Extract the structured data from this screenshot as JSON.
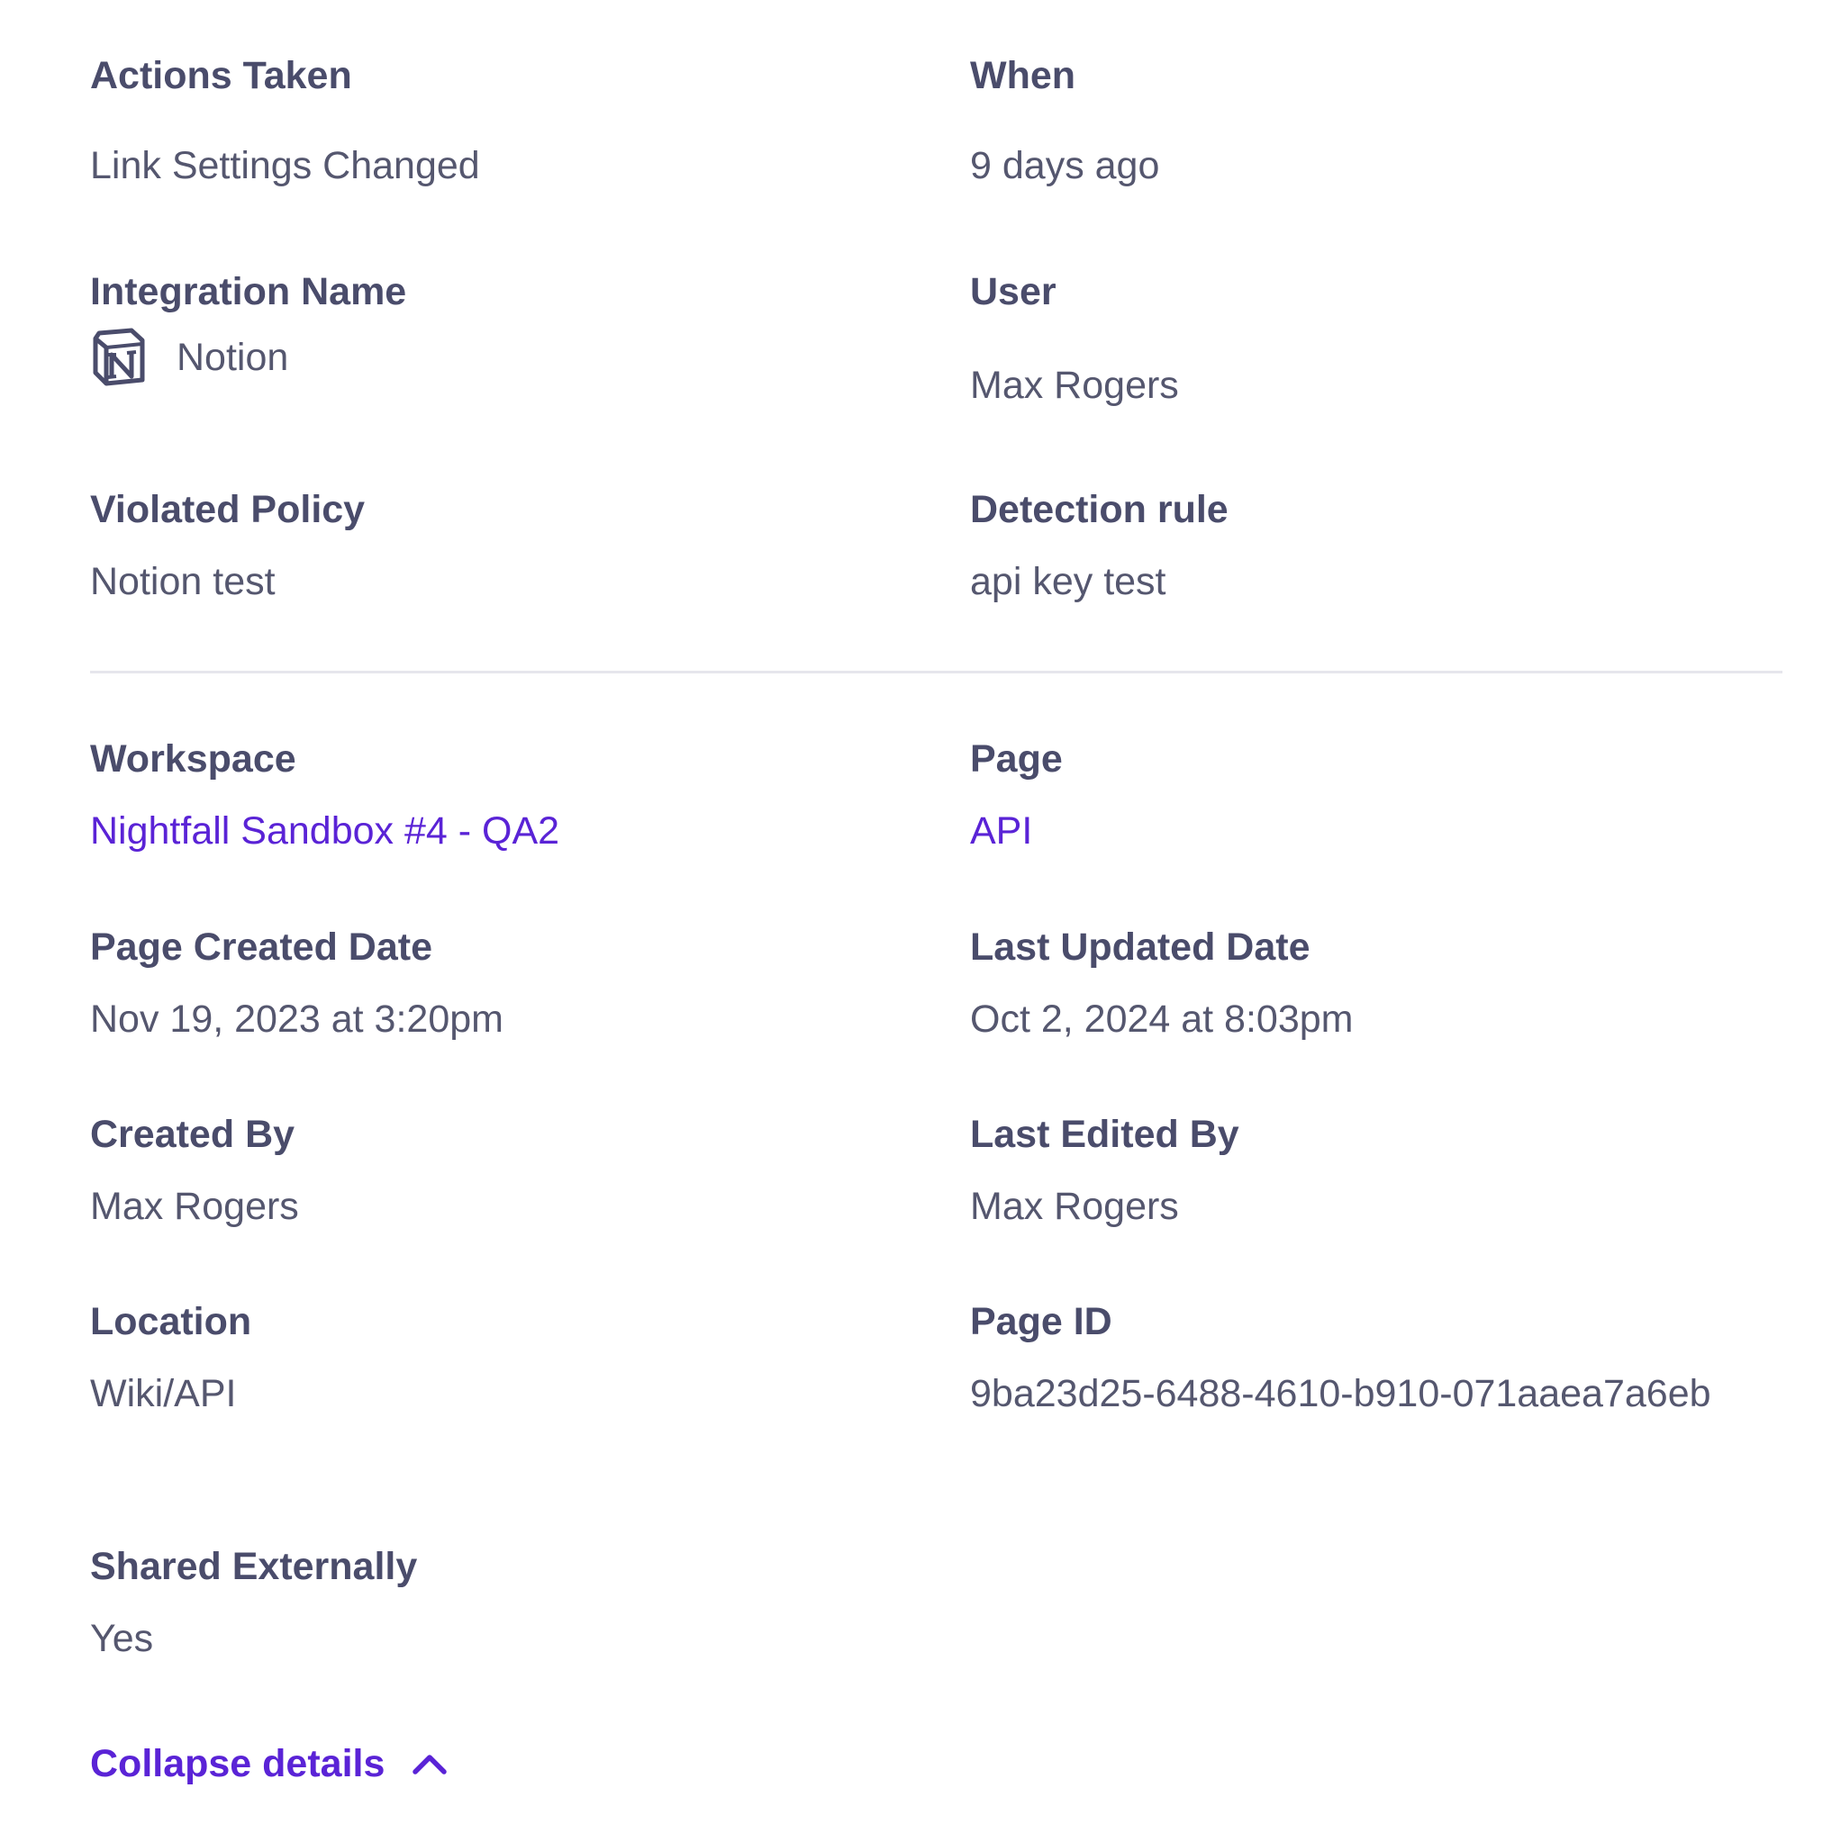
{
  "summary": {
    "actions_taken": {
      "label": "Actions Taken",
      "value": "Link Settings Changed"
    },
    "when": {
      "label": "When",
      "value": "9 days ago"
    },
    "integration_name": {
      "label": "Integration Name",
      "value": "Notion",
      "icon": "notion-icon"
    },
    "user": {
      "label": "User",
      "value": "Max Rogers"
    },
    "violated_policy": {
      "label": "Violated Policy",
      "value": "Notion test"
    },
    "detection_rule": {
      "label": "Detection rule",
      "value": "api key test"
    }
  },
  "details": {
    "workspace": {
      "label": "Workspace",
      "value": "Nightfall Sandbox #4 - QA2"
    },
    "page": {
      "label": "Page",
      "value": "API"
    },
    "page_created_date": {
      "label": "Page Created Date",
      "value": "Nov 19, 2023 at 3:20pm"
    },
    "last_updated_date": {
      "label": "Last Updated Date",
      "value": "Oct 2, 2024 at 8:03pm"
    },
    "created_by": {
      "label": "Created By",
      "value": "Max Rogers"
    },
    "last_edited_by": {
      "label": "Last Edited By",
      "value": "Max Rogers"
    },
    "location": {
      "label": "Location",
      "value": "Wiki/API"
    },
    "page_id": {
      "label": "Page ID",
      "value": "9ba23d25-6488-4610-b910-071aaea7a6eb"
    },
    "shared_externally": {
      "label": "Shared Externally",
      "value": "Yes"
    }
  },
  "collapse": {
    "label": "Collapse details",
    "icon": "chevron-up-icon"
  },
  "colors": {
    "label_text": "#4a4c6b",
    "value_text": "#55576f",
    "link": "#5a23d6",
    "divider": "#e6e6ec"
  }
}
